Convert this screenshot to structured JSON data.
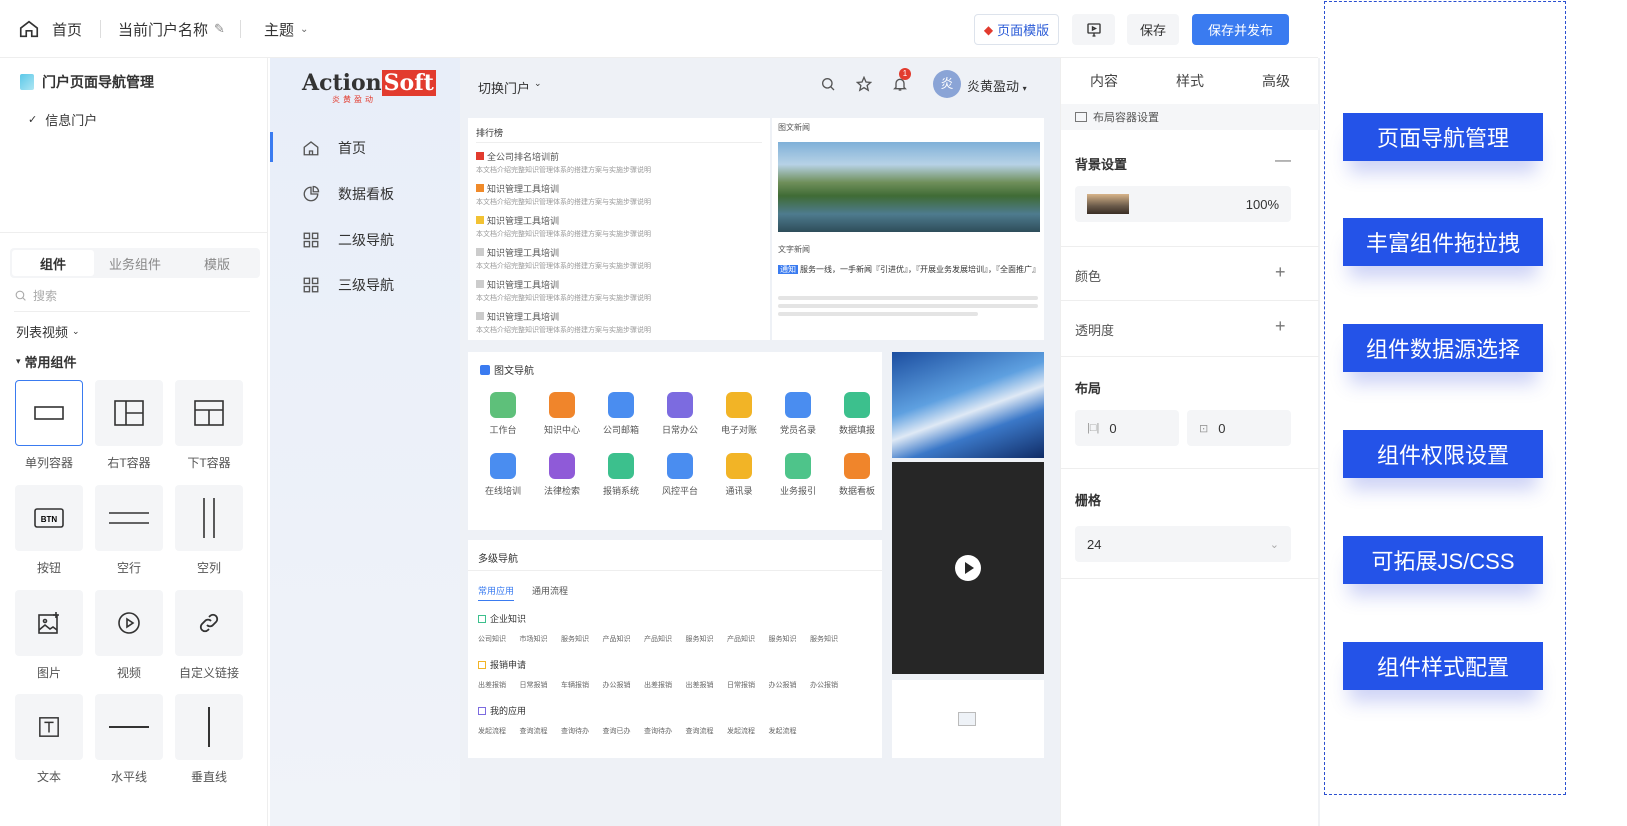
{
  "topbar": {
    "home": "首页",
    "portal_name": "当前门户名称",
    "theme": "主题",
    "template_btn": "页面模版",
    "save_btn": "保存",
    "publish_btn": "保存并发布"
  },
  "left_panel": {
    "tree_title": "门户页面导航管理",
    "tree_child": "信息门户",
    "tabs": [
      "组件",
      "业务组件",
      "模版"
    ],
    "search_placeholder": "搜索",
    "list_view": "列表视频",
    "common": "常用组件",
    "components": [
      "单列容器",
      "右T容器",
      "下T容器",
      "按钮",
      "空行",
      "空列",
      "图片",
      "视频",
      "自定义链接",
      "文本",
      "水平线",
      "垂直线"
    ]
  },
  "side_nav": {
    "logo_text": "Acti",
    "logo_text2": "on",
    "logo_red": "Soft",
    "logo_sub": "炎黄盈动",
    "items": [
      "首页",
      "数据看板",
      "二级导航",
      "三级导航"
    ]
  },
  "portal": {
    "switch": "切换门户",
    "user": "炎黄盈动",
    "avatar": "炎",
    "badge": "1",
    "ranking_title": "排行榜",
    "ranking_first": "全公司排名培训前",
    "ranking_item": "知识管理工具培训",
    "ranking_sub": "本文档介绍完整知识管理体系的搭建方案与实施步骤说明",
    "news_title": "图文新闻",
    "news2_title": "文字新闻",
    "news2_tag": "通知",
    "news2_headline": "服务一线，一手新闻『引进优』，『开展业务发展培训』，『全面推广』",
    "img_nav_title": "图文导航",
    "apps": [
      "工作台",
      "知识中心",
      "公司邮箱",
      "日常办公",
      "电子对账",
      "党员名录",
      "数据填报",
      "在线培训",
      "法律检索",
      "报销系统",
      "风控平台",
      "通讯录",
      "业务报引",
      "数据看板"
    ],
    "multi_title": "多级导航",
    "multi_tabs": [
      "常用应用",
      "通用流程"
    ],
    "groups": [
      {
        "name": "企业知识",
        "items": [
          "公司知识",
          "市场知识",
          "服务知识",
          "产品知识",
          "产品知识",
          "服务知识",
          "产品知识",
          "服务知识",
          "服务知识"
        ]
      },
      {
        "name": "报销申请",
        "items": [
          "出差报销",
          "日常报销",
          "车辆报销",
          "办公报销",
          "出差报销",
          "出差报销",
          "日常报销",
          "办公报销",
          "办公报销"
        ]
      },
      {
        "name": "我的应用",
        "items": [
          "发起流程",
          "查询流程",
          "查询待办",
          "查询已办",
          "查询待办",
          "查询流程",
          "发起流程",
          "发起流程"
        ]
      }
    ]
  },
  "right_panel": {
    "tabs": [
      "内容",
      "样式",
      "高级"
    ],
    "layout_setting": "布局容器设置",
    "bg": "背景设置",
    "bg_opacity": "100%",
    "color": "颜色",
    "opacity": "透明度",
    "layout": "布局",
    "gap1": "0",
    "gap2": "0",
    "grid": "栅格",
    "grid_val": "24"
  },
  "features": [
    "页面导航管理",
    "丰富组件拖拉拽",
    "组件数据源选择",
    "组件权限设置",
    "可拓展JS/CSS",
    "组件样式配置"
  ],
  "colors": {
    "accent": "#3a7bf0",
    "feature": "#2453e8",
    "logo_red": "#e23b2e"
  }
}
